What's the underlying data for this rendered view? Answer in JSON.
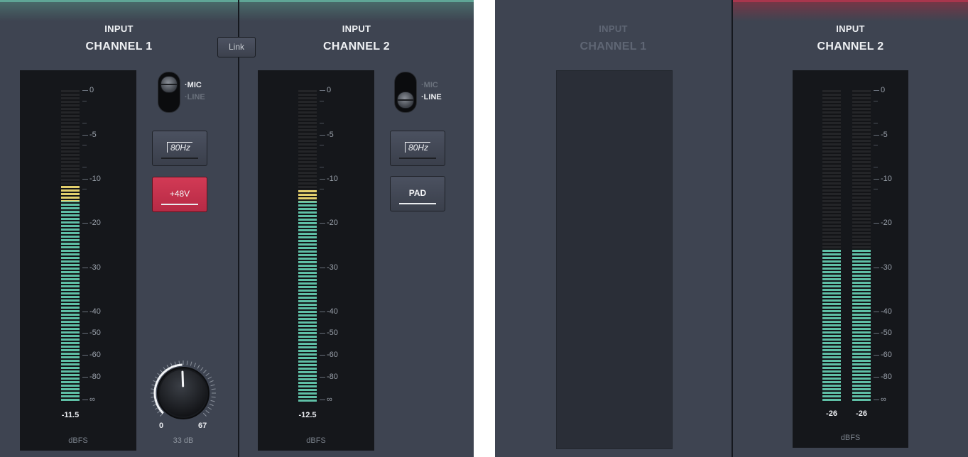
{
  "left_panel": {
    "link_label": "Link",
    "channels": [
      {
        "header_sub": "INPUT",
        "header_main": "CHANNEL 1",
        "meter": {
          "level_db": -11.5,
          "peak_label": "-11.5",
          "unit": "dBFS"
        },
        "toggle": {
          "upper_label": "·MIC",
          "lower_label": "·LINE",
          "selected": "MIC"
        },
        "hpf_button": {
          "label": "80Hz",
          "active": false
        },
        "phantom_button": {
          "label": "+48V",
          "active": true
        },
        "knob": {
          "min_label": "0",
          "max_label": "67",
          "gain_text": "33 dB",
          "min_db": 0,
          "max_db": 67,
          "value_db": 33
        }
      },
      {
        "header_sub": "INPUT",
        "header_main": "CHANNEL 2",
        "meter": {
          "level_db": -12.5,
          "peak_label": "-12.5",
          "unit": "dBFS"
        },
        "toggle": {
          "upper_label": "·MIC",
          "lower_label": "·LINE",
          "selected": "LINE"
        },
        "hpf_button": {
          "label": "80Hz",
          "active": false
        },
        "pad_button": {
          "label": "PAD",
          "active": true
        }
      }
    ]
  },
  "right_panel": {
    "channels": [
      {
        "header_sub": "INPUT",
        "header_main": "CHANNEL 1",
        "state": "disabled"
      },
      {
        "header_sub": "INPUT",
        "header_main": "CHANNEL 2",
        "meter": {
          "left_db": -26,
          "right_db": -26,
          "left_label": "-26",
          "right_label": "-26",
          "unit": "dBFS"
        }
      }
    ]
  },
  "meter_scale": [
    "0",
    "-5",
    "-10",
    "-20",
    "-30",
    "-40",
    "-50",
    "-60",
    "-80",
    "∞"
  ],
  "colors": {
    "meter_green": "#5fbfa6",
    "meter_yellow": "#e3cf6d",
    "phantom_red": "#c8304d",
    "left_accent": "#4a9c8c",
    "right_accent": "#9e3148"
  }
}
